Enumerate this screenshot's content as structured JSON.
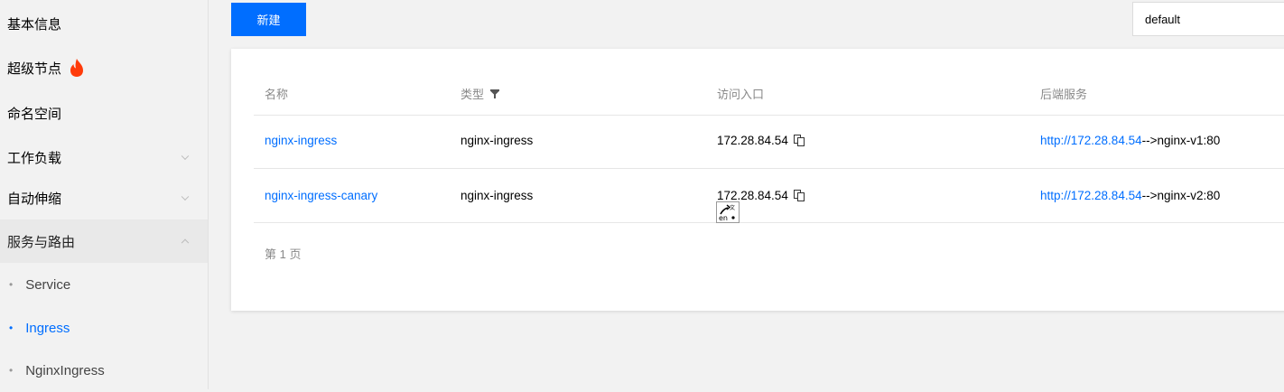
{
  "sidebar": {
    "items": [
      {
        "label": "基本信息"
      },
      {
        "label": "超级节点"
      },
      {
        "label": "命名空间"
      },
      {
        "label": "工作负载"
      },
      {
        "label": "自动伸缩"
      },
      {
        "label": "服务与路由"
      }
    ],
    "sub_items": [
      {
        "label": "Service"
      },
      {
        "label": "Ingress"
      },
      {
        "label": "NginxIngress"
      }
    ]
  },
  "toolbar": {
    "new_label": "新建",
    "namespace_value": "default"
  },
  "table": {
    "headers": [
      "名称",
      "类型",
      "访问入口",
      "后端服务"
    ],
    "rows": [
      {
        "name": "nginx-ingress",
        "type": "nginx-ingress",
        "entry": "172.28.84.54",
        "backend_link": "http://172.28.84.54",
        "backend_target": "-->nginx-v1:80"
      },
      {
        "name": "nginx-ingress-canary",
        "type": "nginx-ingress",
        "entry": "172.28.84.54",
        "backend_link": "http://172.28.84.54",
        "backend_target": "-->nginx-v2:80"
      }
    ]
  },
  "pager": {
    "label": "第 1 页"
  },
  "colors": {
    "accent": "#006eff",
    "fire": "#ff3b0a"
  },
  "icons": [
    "fire-icon",
    "chevron-down-icon",
    "chevron-up-icon",
    "filter-icon",
    "copy-icon",
    "translate-icon"
  ]
}
